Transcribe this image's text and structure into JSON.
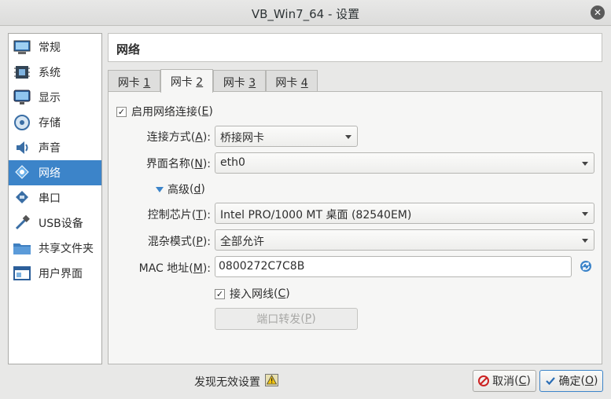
{
  "window": {
    "title": "VB_Win7_64 - 设置"
  },
  "sidebar": {
    "items": [
      {
        "label": "常规",
        "icon": "general-icon"
      },
      {
        "label": "系统",
        "icon": "system-icon"
      },
      {
        "label": "显示",
        "icon": "display-icon"
      },
      {
        "label": "存储",
        "icon": "storage-icon"
      },
      {
        "label": "声音",
        "icon": "audio-icon"
      },
      {
        "label": "网络",
        "icon": "network-icon",
        "active": true
      },
      {
        "label": "串口",
        "icon": "serial-port-icon"
      },
      {
        "label": "USB设备",
        "icon": "usb-icon"
      },
      {
        "label": "共享文件夹",
        "icon": "shared-folder-icon"
      },
      {
        "label": "用户界面",
        "icon": "user-interface-icon"
      }
    ]
  },
  "header": {
    "title": "网络"
  },
  "tabs": [
    {
      "prefix": "网卡 ",
      "key": "1"
    },
    {
      "prefix": "网卡 ",
      "key": "2",
      "active": true
    },
    {
      "prefix": "网卡 ",
      "key": "3"
    },
    {
      "prefix": "网卡 ",
      "key": "4"
    }
  ],
  "form": {
    "enable": {
      "label": "启用网络连接",
      "key": "E",
      "checked": true
    },
    "attached": {
      "label": "连接方式",
      "key": "A",
      "value": "桥接网卡"
    },
    "name": {
      "label": "界面名称",
      "key": "N",
      "value": "eth0"
    },
    "advanced": {
      "label": "高级",
      "key": "d"
    },
    "adapter": {
      "label": "控制芯片",
      "key": "T",
      "value": "Intel PRO/1000 MT 桌面 (82540EM)"
    },
    "promisc": {
      "label": "混杂模式",
      "key": "P",
      "value": "全部允许"
    },
    "mac": {
      "label": "MAC 地址",
      "key": "M",
      "value": "0800272C7C8B"
    },
    "cable": {
      "label": "接入网线",
      "key": "C",
      "checked": true
    },
    "portfwd": {
      "label": "端口转发",
      "key": "P"
    }
  },
  "footer": {
    "warning": "发现无效设置",
    "cancel": {
      "label": "取消",
      "key": "C"
    },
    "ok": {
      "label": "确定",
      "key": "O"
    }
  },
  "colors": {
    "accent": "#3c84c9"
  }
}
